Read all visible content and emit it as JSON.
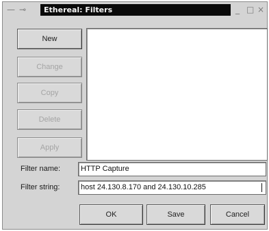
{
  "window": {
    "title": "Ethereal: Filters",
    "controls": {
      "minimize_glyph": "_",
      "maximize_glyph": "□",
      "close_glyph": "×",
      "menu_glyph": "⊸"
    }
  },
  "buttons": {
    "new": "New",
    "change": "Change",
    "copy": "Copy",
    "delete": "Delete",
    "apply": "Apply",
    "ok": "OK",
    "save": "Save",
    "cancel": "Cancel"
  },
  "filter_list": {
    "items": []
  },
  "form": {
    "filter_name_label": "Filter name:",
    "filter_name_value": "HTTP Capture",
    "filter_string_label": "Filter string:",
    "filter_string_value": "host 24.130.8.170 and 24.130.10.285"
  }
}
